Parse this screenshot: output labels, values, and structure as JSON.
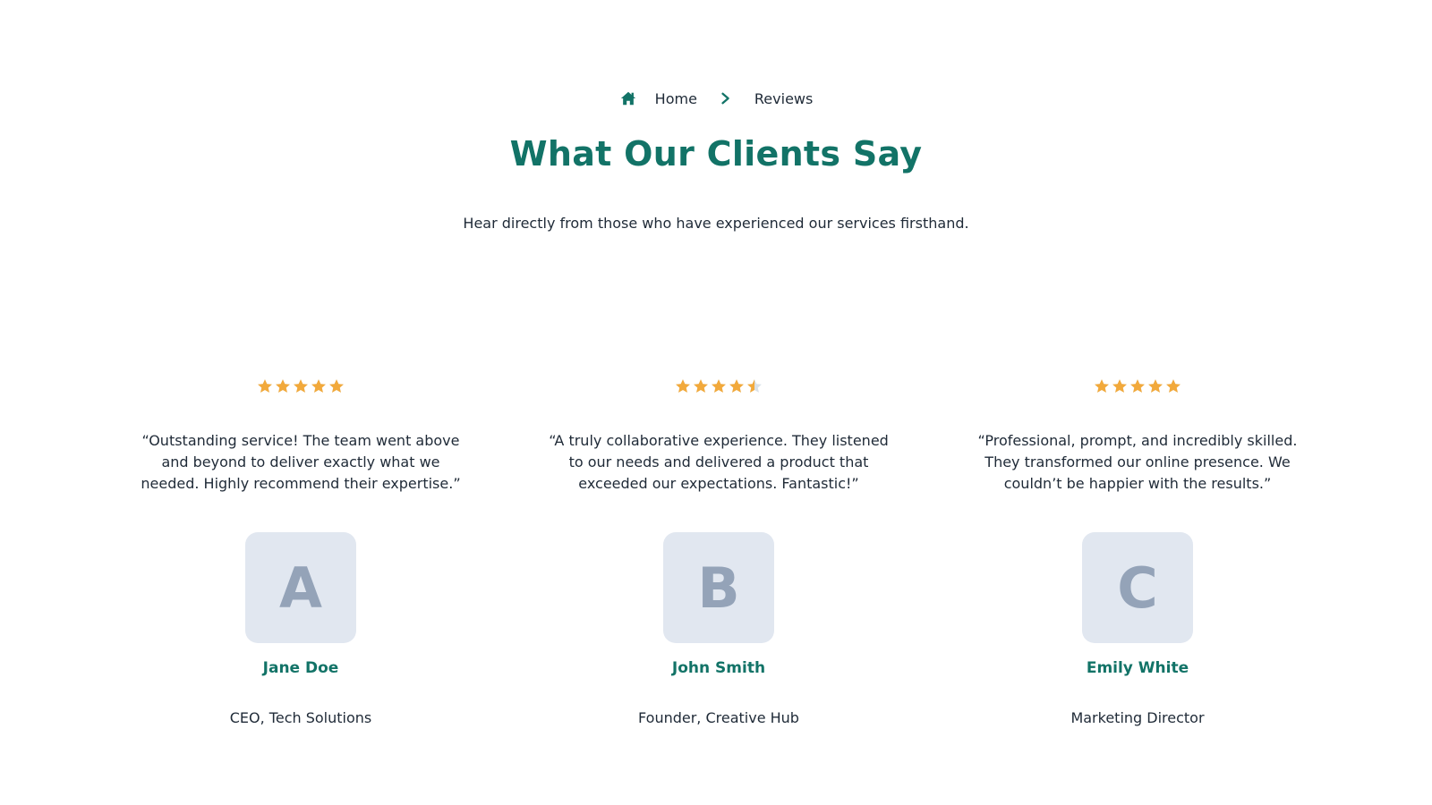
{
  "breadcrumb": {
    "home_icon": "home-icon",
    "home_label": "Home",
    "separator_icon": "chevron-right-icon",
    "current_label": "Reviews"
  },
  "heading": {
    "title": "What Our Clients Say",
    "subtitle": "Hear directly from those who have experienced our services firsthand."
  },
  "colors": {
    "accent": "#127367",
    "star": "#F2A93B",
    "star_empty": "#D9E1E8",
    "avatar_bg": "#E1E7F0",
    "avatar_text": "#94A3B8"
  },
  "testimonials": [
    {
      "rating": 5,
      "max_rating": 5,
      "quote": "“Outstanding service! The team went above and beyond to deliver exactly what we needed. Highly recommend their expertise.”",
      "avatar_letter": "A",
      "name": "Jane Doe",
      "role": "CEO, Tech Solutions"
    },
    {
      "rating": 4.5,
      "max_rating": 5,
      "quote": "“A truly collaborative experience. They listened to our needs and delivered a product that exceeded our expectations. Fantastic!”",
      "avatar_letter": "B",
      "name": "John Smith",
      "role": "Founder, Creative Hub"
    },
    {
      "rating": 5,
      "max_rating": 5,
      "quote": "“Professional, prompt, and incredibly skilled. They transformed our online presence. We couldn’t be happier with the results.”",
      "avatar_letter": "C",
      "name": "Emily White",
      "role": "Marketing Director"
    }
  ]
}
